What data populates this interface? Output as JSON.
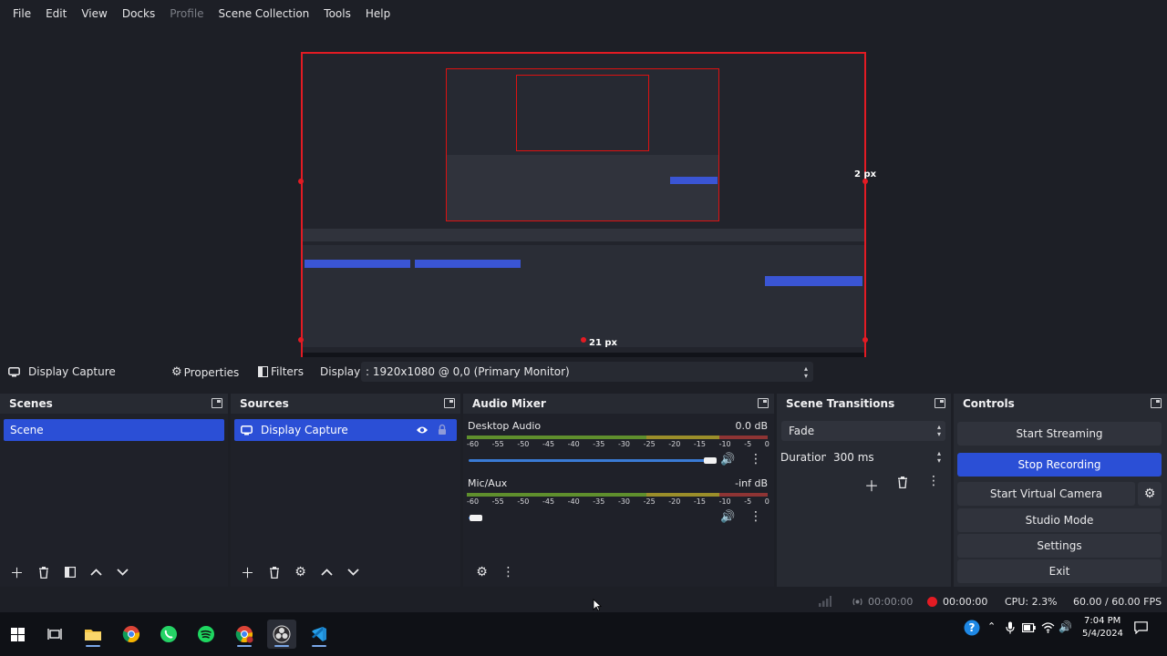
{
  "menu": [
    "File",
    "Edit",
    "View",
    "Docks",
    "Profile",
    "Scene Collection",
    "Tools",
    "Help"
  ],
  "preview": {
    "size_label_right": "2 px",
    "size_label_bottom": "21 px"
  },
  "source_toolbar": {
    "source_name": "Display Capture",
    "properties_label": "Properties",
    "filters_label": "Filters",
    "display_label": "Display",
    "display_value": ": 1920x1080 @ 0,0 (Primary Monitor)"
  },
  "scenes": {
    "title": "Scenes",
    "items": [
      "Scene"
    ]
  },
  "sources": {
    "title": "Sources",
    "items": [
      "Display Capture"
    ]
  },
  "audio_mixer": {
    "title": "Audio Mixer",
    "ticks": [
      "-60",
      "-55",
      "-50",
      "-45",
      "-40",
      "-35",
      "-30",
      "-25",
      "-20",
      "-15",
      "-10",
      "-5",
      "0"
    ],
    "channels": [
      {
        "name": "Desktop Audio",
        "level": "0.0 dB",
        "volume_fraction": 0.98
      },
      {
        "name": "Mic/Aux",
        "level": "-inf dB",
        "volume_fraction": 0.03
      }
    ]
  },
  "scene_transitions": {
    "title": "Scene Transitions",
    "transition": "Fade",
    "duration_label": "Duration",
    "duration_value": "300 ms"
  },
  "controls": {
    "title": "Controls",
    "start_streaming": "Start Streaming",
    "stop_recording": "Stop Recording",
    "start_virtual_camera": "Start Virtual Camera",
    "studio_mode": "Studio Mode",
    "settings": "Settings",
    "exit": "Exit"
  },
  "status": {
    "stream_time": "00:00:00",
    "record_time": "00:00:00",
    "cpu": "CPU: 2.3%",
    "fps": "60.00 / 60.00 FPS"
  },
  "taskbar": {
    "time": "7:04 PM",
    "date": "5/4/2024"
  },
  "colors": {
    "accent": "#2b4fd6",
    "preview_border": "#e31b23",
    "record_dot": "#e31b23"
  }
}
